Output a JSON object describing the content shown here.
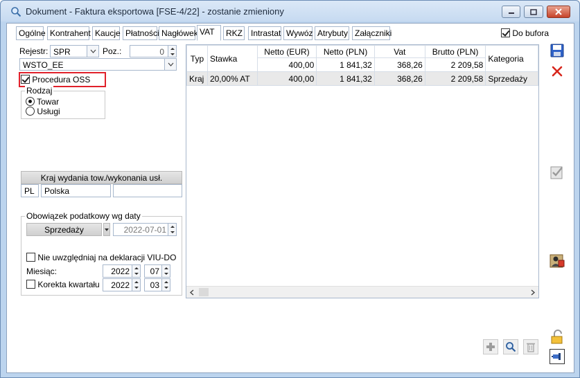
{
  "window": {
    "title": "Dokument - Faktura eksportowa [FSE-4/22]  - zostanie zmieniony"
  },
  "tabs": [
    {
      "label": "Ogólne"
    },
    {
      "label": "Kontrahent"
    },
    {
      "label": "Kaucje"
    },
    {
      "label": "Płatności"
    },
    {
      "label": "Nagłówek"
    },
    {
      "label": "VAT"
    },
    {
      "label": "RKZ"
    },
    {
      "label": "Intrastat"
    },
    {
      "label": "Wywóz"
    },
    {
      "label": "Atrybuty"
    },
    {
      "label": "Załączniki"
    }
  ],
  "active_tab": "VAT",
  "do_bufora": {
    "label": "Do bufora",
    "checked": true
  },
  "left": {
    "rejestr_label": "Rejestr:",
    "rejestr_value": "SPR",
    "poz_label": "Poz.:",
    "poz_value": "0",
    "register_select": "WSTO_EE",
    "procedura_oss": {
      "label": "Procedura OSS",
      "checked": true
    },
    "rodzaj": {
      "title": "Rodzaj",
      "options": [
        "Towar",
        "Usługi"
      ],
      "selected": "Towar"
    },
    "kraj_button": "Kraj wydania tow./wykonania usł.",
    "kraj_code": "PL",
    "kraj_name": "Polska",
    "kraj_extra": "",
    "obowiazek": {
      "title": "Obowiązek podatkowy wg daty",
      "type_value": "Sprzedaży",
      "date_value": "2022-07-01"
    },
    "nie_uwzgledniaj": {
      "label": "Nie uwzględniaj na deklaracji VIU-DO",
      "checked": false
    },
    "miesiac": {
      "label": "Miesiąc:",
      "year": "2022",
      "month": "07"
    },
    "korekta": {
      "label": "Korekta kwartału",
      "checked": false,
      "year": "2022",
      "quarter": "03"
    }
  },
  "grid": {
    "columns": [
      "Typ",
      "Stawka",
      "Netto (EUR)",
      "Netto (PLN)",
      "Vat",
      "Brutto (PLN)",
      "Kategoria"
    ],
    "totals": {
      "netto_eur": "400,00",
      "netto_pln": "1 841,32",
      "vat": "368,26",
      "brutto_pln": "2 209,58"
    },
    "rows": [
      {
        "typ": "Kraj",
        "stawka": "20,00% AT",
        "netto_eur": "400,00",
        "netto_pln": "1 841,32",
        "vat": "368,26",
        "brutto_pln": "2 209,58",
        "kategoria": "Sprzedaży"
      }
    ]
  },
  "icons": {
    "save": "save-icon",
    "delete": "delete-x-icon",
    "approve": "approve-check-icon",
    "person": "person-card-icon",
    "lock": "lock-icon",
    "pin": "pin-icon",
    "add": "add-plus-icon",
    "search": "magnifier-icon",
    "trash": "trash-icon"
  }
}
